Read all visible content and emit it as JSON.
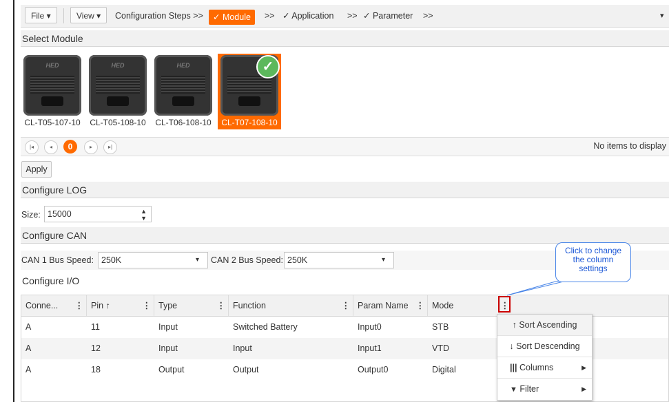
{
  "toolbar": {
    "file_label": "File ▾",
    "view_label": "View ▾",
    "steps_prefix": "Configuration Steps >>",
    "step_module": "✓ Module",
    "sep1": ">>",
    "step_application": "✓ Application",
    "sep2": ">>",
    "step_parameter": "✓ Parameter",
    "sep3": ">>",
    "overflow": "▾"
  },
  "sections": {
    "select_module": "Select Module",
    "configure_log": "Configure LOG",
    "configure_can": "Configure CAN",
    "configure_io": "Configure I/O"
  },
  "modules": [
    {
      "label": "CL-T05-107-10",
      "logo": "HED",
      "selected": false
    },
    {
      "label": "CL-T05-108-10",
      "logo": "HED",
      "selected": false
    },
    {
      "label": "CL-T06-108-10",
      "logo": "HED",
      "selected": false
    },
    {
      "label": "CL-T07-108-10",
      "logo": "",
      "selected": true
    }
  ],
  "pager": {
    "first_icon": "first-page-icon",
    "prev_icon": "prev-page-icon",
    "current_page": "0",
    "next_icon": "next-page-icon",
    "last_icon": "last-page-icon",
    "status": "No items to display"
  },
  "apply_label": "Apply",
  "log": {
    "size_label": "Size:",
    "size_value": "15000"
  },
  "can": {
    "bus1_label": "CAN 1 Bus Speed:",
    "bus1_value": "250K",
    "bus2_label": "CAN 2 Bus Speed:",
    "bus2_value": "250K"
  },
  "grid": {
    "columns": [
      "Conne...",
      "Pin ↑",
      "Type",
      "Function",
      "Param Name",
      "Mode"
    ],
    "rows": [
      [
        "A",
        "11",
        "Input",
        "Switched Battery",
        "Input0",
        "STB"
      ],
      [
        "A",
        "12",
        "Input",
        "Input",
        "Input1",
        "VTD"
      ],
      [
        "A",
        "18",
        "Output",
        "Output",
        "Output0",
        "Digital"
      ]
    ]
  },
  "column_menu": {
    "sort_asc": "↑ Sort Ascending",
    "sort_desc": "↓ Sort Descending",
    "columns": "Columns",
    "filter": "Filter"
  },
  "callout": {
    "text1": "Click to change",
    "text2": "the column",
    "text3": "settings"
  },
  "colors": {
    "accent": "#ff6a00",
    "callout": "#1a56d6",
    "highlight": "#cc0000"
  }
}
